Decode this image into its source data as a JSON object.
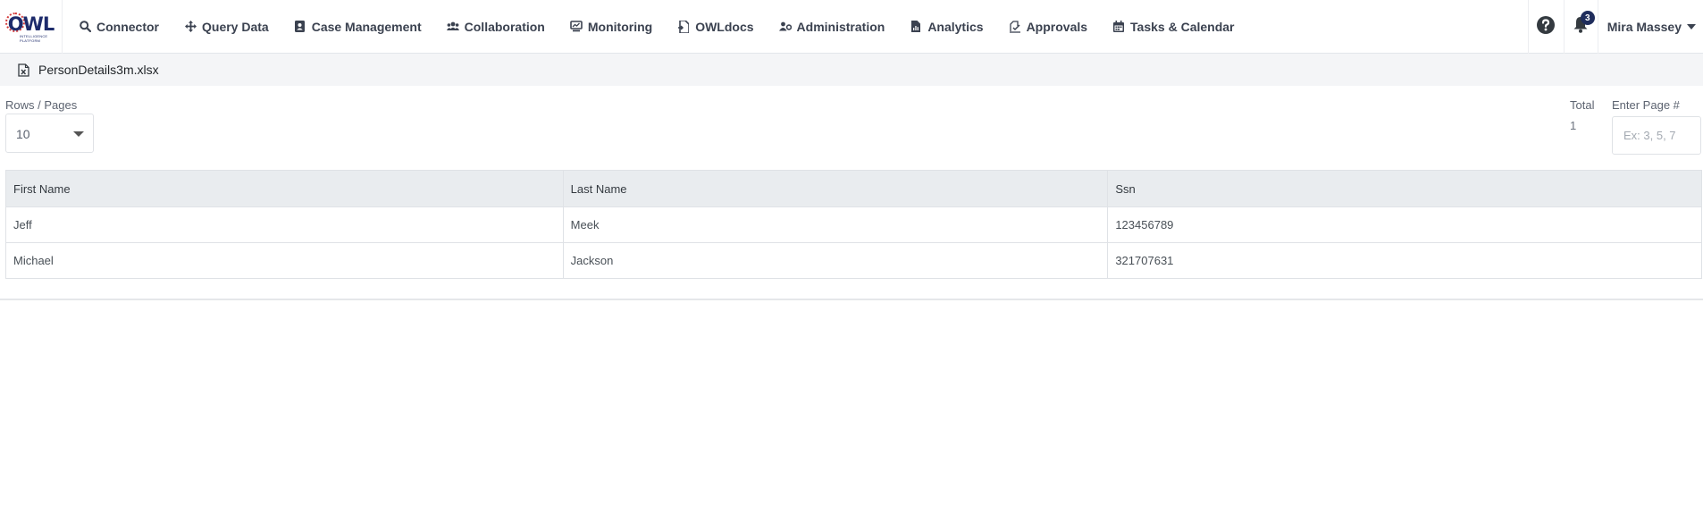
{
  "brand": {
    "logo_text": "OWL",
    "logo_sub": "INTELLIGENCE PLATFORM"
  },
  "nav": {
    "items": [
      {
        "label": "Connector",
        "icon": "search-icon"
      },
      {
        "label": "Query Data",
        "icon": "move-icon"
      },
      {
        "label": "Case Management",
        "icon": "contact-book-icon"
      },
      {
        "label": "Collaboration",
        "icon": "users-icon"
      },
      {
        "label": "Monitoring",
        "icon": "monitor-icon"
      },
      {
        "label": "OWLdocs",
        "icon": "document-icon"
      },
      {
        "label": "Administration",
        "icon": "users-cog-icon"
      },
      {
        "label": "Analytics",
        "icon": "file-chart-icon"
      },
      {
        "label": "Approvals",
        "icon": "approval-icon"
      },
      {
        "label": "Tasks & Calendar",
        "icon": "calendar-icon"
      }
    ]
  },
  "header": {
    "help_icon": "question-circle-icon",
    "notifications": {
      "icon": "bell-icon",
      "count": "3"
    },
    "user_name": "Mira Massey"
  },
  "file": {
    "name": "PersonDetails3m.xlsx",
    "icon": "excel-file-icon"
  },
  "controls": {
    "rows_label": "Rows / Pages",
    "rows_value": "10",
    "total_label": "Total",
    "total_value": "1",
    "page_label": "Enter Page #",
    "page_placeholder": "Ex: 3, 5, 7"
  },
  "table": {
    "columns": [
      "First Name",
      "Last Name",
      "Ssn"
    ],
    "rows": [
      [
        "Jeff",
        "Meek",
        "123456789"
      ],
      [
        "Michael",
        "Jackson",
        "321707631"
      ]
    ]
  },
  "colors": {
    "nav_text": "#3b4250",
    "badge": "#1f2d5c",
    "header_bg": "#e9ecef",
    "logo_red": "#d43a3a",
    "logo_blue": "#1d2b6b"
  }
}
